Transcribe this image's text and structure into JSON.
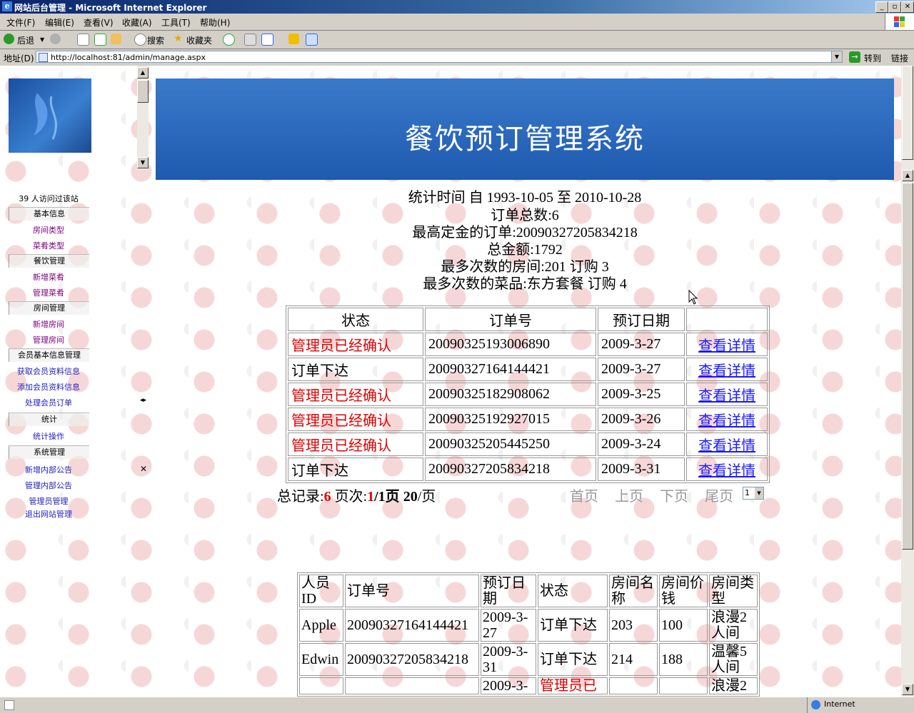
{
  "window": {
    "title": "网站后台管理 - Microsoft Internet Explorer"
  },
  "menubar": {
    "items": [
      "文件(F)",
      "编辑(E)",
      "查看(V)",
      "收藏(A)",
      "工具(T)",
      "帮助(H)"
    ]
  },
  "toolbar": {
    "back": "后退",
    "search": "搜索",
    "favorites": "收藏夹"
  },
  "address": {
    "label": "地址(D)",
    "url": "http://localhost:81/admin/manage.aspx",
    "go": "转到",
    "links": "链接"
  },
  "sidebar": {
    "visitors": "39 人访问过该站",
    "sections": [
      {
        "title": "基本信息",
        "items": [
          "房间类型",
          "菜肴类型"
        ]
      },
      {
        "title": "餐饮管理",
        "items": [
          "新增菜肴",
          "管理菜肴"
        ]
      },
      {
        "title": "房间管理",
        "items": [
          "新增房间",
          "管理房间"
        ]
      },
      {
        "title": "会员基本信息管理",
        "items": [
          "获取会员资料信息",
          "添加会员资料信息",
          "处理会员订单"
        ]
      },
      {
        "title": "统计",
        "items": [
          "统计操作"
        ]
      },
      {
        "title": "系统管理",
        "items": [
          "新增内部公告",
          "管理内部公告",
          "管理员管理",
          "退出网站管理"
        ]
      }
    ]
  },
  "banner": {
    "title": "餐饮预订管理系统"
  },
  "stats": {
    "period": "统计时间  自  1993-10-05 至  2010-10-28",
    "total_orders": "订单总数:6",
    "top_deposit": "最高定金的订单:20090327205834218",
    "total_amount": "总金额:1792",
    "top_room": "最多次数的房间:201 订购  3",
    "top_dish": "最多次数的菜品:东方套餐  订购  4"
  },
  "orders": {
    "headers": [
      "状态",
      "订单号",
      "预订日期",
      ""
    ],
    "link_text": "查看详情",
    "rows": [
      {
        "status": "管理员已经确认",
        "confirmed": true,
        "id": "20090325193006890",
        "date": "2009-3-27"
      },
      {
        "status": "订单下达",
        "confirmed": false,
        "id": "20090327164144421",
        "date": "2009-3-27"
      },
      {
        "status": "管理员已经确认",
        "confirmed": true,
        "id": "20090325182908062",
        "date": "2009-3-25"
      },
      {
        "status": "管理员已经确认",
        "confirmed": true,
        "id": "20090325192927015",
        "date": "2009-3-26"
      },
      {
        "status": "管理员已经确认",
        "confirmed": true,
        "id": "20090325205445250",
        "date": "2009-3-24"
      },
      {
        "status": "订单下达",
        "confirmed": false,
        "id": "20090327205834218",
        "date": "2009-3-31"
      }
    ]
  },
  "pager": {
    "total_label": "总记录:",
    "total": "6",
    "page_label": "页次:",
    "page": "1",
    "pages": "/1页",
    "size": "20",
    "size_unit": "/页",
    "first": "首页",
    "prev": "上页",
    "next": "下页",
    "last": "尾页",
    "select": "1"
  },
  "members": {
    "headers": [
      "人员ID",
      "订单号",
      "预订日期",
      "状态",
      "房间名称",
      "房间价钱",
      "房间类型"
    ],
    "rows": [
      {
        "user": "Apple",
        "id": "20090327164144421",
        "date": "2009-3-27",
        "status": "订单下达",
        "room": "203",
        "price": "100",
        "type": "浪漫2人间"
      },
      {
        "user": "Edwin",
        "id": "20090327205834218",
        "date": "2009-3-31",
        "status": "订单下达",
        "room": "214",
        "price": "188",
        "type": "温馨5人间"
      },
      {
        "user": "",
        "id": "",
        "date": "2009-3-",
        "status": "管理员已",
        "room": "",
        "price": "",
        "type": "浪漫2"
      }
    ]
  },
  "statusbar": {
    "zone": "Internet"
  }
}
